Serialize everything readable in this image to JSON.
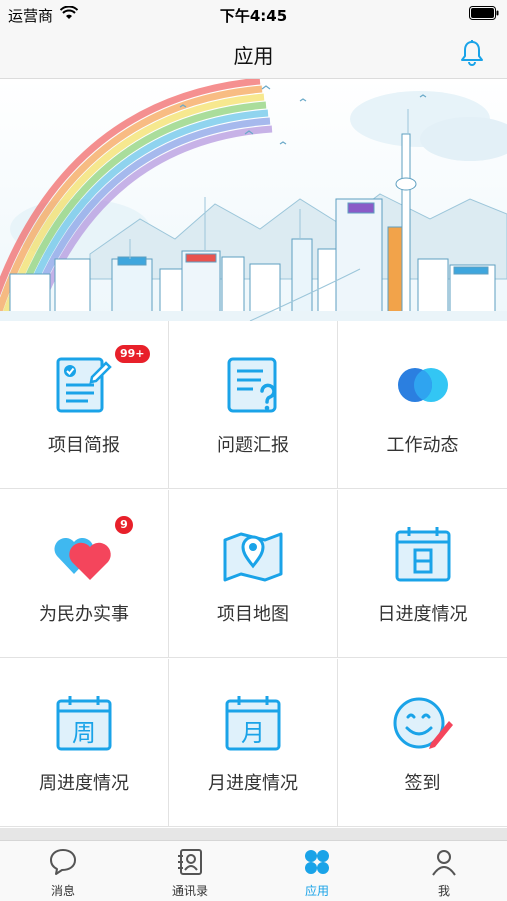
{
  "status_bar": {
    "carrier": "运营商",
    "time": "下午4:45"
  },
  "nav": {
    "title": "应用"
  },
  "grid": [
    {
      "label": "项目简报",
      "icon": "document-edit-icon",
      "badge": "99+"
    },
    {
      "label": "问题汇报",
      "icon": "question-doc-icon"
    },
    {
      "label": "工作动态",
      "icon": "overlap-circles-icon"
    },
    {
      "label": "为民办实事",
      "icon": "hearts-icon",
      "badge": "9"
    },
    {
      "label": "项目地图",
      "icon": "map-pin-icon"
    },
    {
      "label": "日进度情况",
      "icon": "calendar-day-icon",
      "glyph": "日"
    },
    {
      "label": "周进度情况",
      "icon": "calendar-week-icon",
      "glyph": "周"
    },
    {
      "label": "月进度情况",
      "icon": "calendar-month-icon",
      "glyph": "月"
    },
    {
      "label": "签到",
      "icon": "smiley-pen-icon"
    }
  ],
  "tabs": [
    {
      "label": "消息",
      "icon": "chat-bubble-icon"
    },
    {
      "label": "通讯录",
      "icon": "contacts-book-icon"
    },
    {
      "label": "应用",
      "icon": "apps-grid-icon",
      "active": true
    },
    {
      "label": "我",
      "icon": "person-icon"
    }
  ],
  "colors": {
    "accent": "#1aa3e8",
    "badge": "#e8202a",
    "heart_red": "#f4455c",
    "heart_blue": "#3fb8f0"
  }
}
